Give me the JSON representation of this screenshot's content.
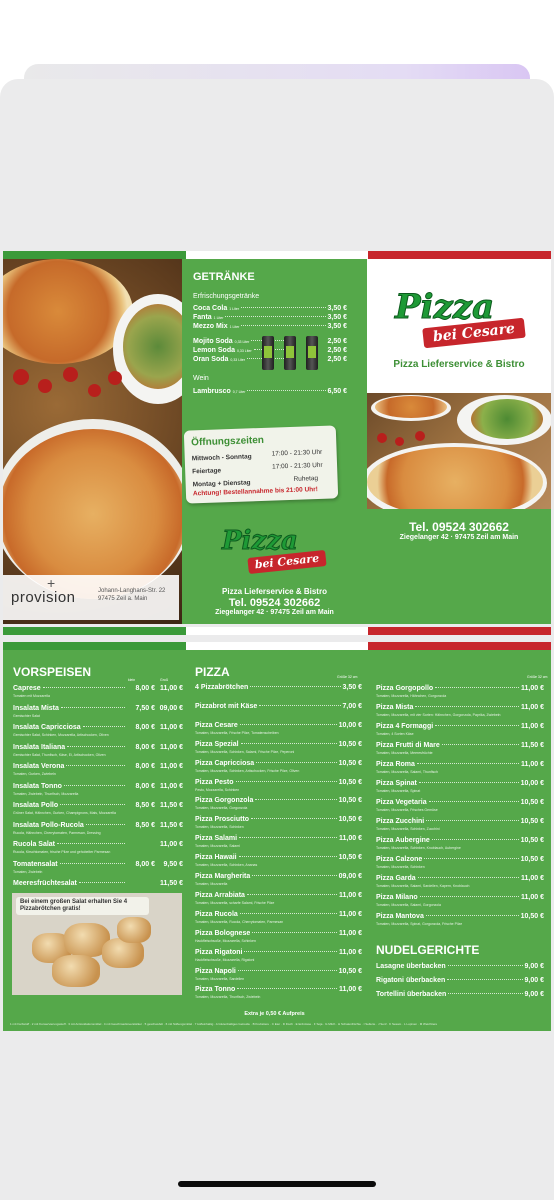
{
  "page": {
    "tops": {
      "getraenke": {
        "title": "GETRÄNKE",
        "group1": "Erfrischungsgetränke",
        "items": [
          {
            "name": "Coca Cola",
            "size": "1 Liter",
            "price": "3,50 €"
          },
          {
            "name": "Fanta",
            "size": "1 Liter",
            "price": "3,50 €"
          },
          {
            "name": "Mezzo Mix",
            "size": "1 Liter",
            "price": "3,50 €"
          },
          {
            "name": "Mojito Soda",
            "size": "0,33 Liter",
            "price": "2,50 €"
          },
          {
            "name": "Lemon Soda",
            "size": "0,33 Liter",
            "price": "2,50 €"
          },
          {
            "name": "Oran Soda",
            "size": "0,33 Liter",
            "price": "2,50 €"
          }
        ],
        "group2": "Wein",
        "wine": {
          "name": "Lambrusco",
          "size": "0,7 Liter",
          "price": "6,50 €"
        }
      },
      "oeffnung": {
        "title": "Öffnungszeiten",
        "rows": [
          {
            "day": "Mittwoch - Sonntag",
            "time": "17:00 - 21:30 Uhr"
          },
          {
            "day": "Feiertage",
            "time": "17:00 - 21:30 Uhr"
          },
          {
            "day": "Montag + Dienstag",
            "time": "Ruhetag"
          }
        ],
        "warning": "Achtung! Bestellannahme bis 21:00 Uhr!"
      },
      "center_logo": {
        "pizza": "Pizza",
        "bei": "bei Cesare"
      },
      "center_info": {
        "name": "Pizza Lieferservice & Bistro",
        "tel": "Tel. 09524  302662",
        "address": "Ziegelanger 42 · 97475 Zeil am Main"
      },
      "right_logo": {
        "pizza": "Pizza",
        "bei": "bei Cesare"
      },
      "right_info": {
        "subtitle": "Pizza Lieferservice & Bistro",
        "tel": "Tel. 09524 302662",
        "address": "Ziegelanger 42 · 97475 Zeil am Main"
      },
      "provision": {
        "brand": "provision",
        "addr1": "Johann-Langhans-Str. 22",
        "addr2": "97475 Zeil a. Main"
      }
    },
    "vorspeisen": {
      "title": "VORSPEISEN",
      "col1": "klein",
      "col2": "Groß",
      "items": [
        {
          "name": "Caprese",
          "desc": "Tomaten mit Mozzarella",
          "p1": "8,00 €",
          "p2": "11,00 €"
        },
        {
          "name": "Insalata Mista",
          "desc": "Gemischter Salat",
          "p1": "7,50 €",
          "p2": "09,00 €"
        },
        {
          "name": "Insalata Capricciosa",
          "desc": "Gemischter Salat, Schinken, Mozzarella, Artischocken, Oliven",
          "p1": "8,00 €",
          "p2": "11,00 €"
        },
        {
          "name": "Insalata Italiana",
          "desc": "Gemischter Salat, Thunfisch, Käse, Ei, Artischocken, Oliven",
          "p1": "8,00 €",
          "p2": "11,00 €"
        },
        {
          "name": "Insalata Verona",
          "desc": "Tomaten, Gurken, Zwiebeln",
          "p1": "8,00 €",
          "p2": "11,00 €"
        },
        {
          "name": "Insalata Tonno",
          "desc": "Tomaten, Zwiebeln, Thunfisch, Mozzarella",
          "p1": "8,00 €",
          "p2": "11,00 €"
        },
        {
          "name": "Insalata Pollo",
          "desc": "Grüner Salat, Hähnchen, Gurken, Champignons, Mais, Mozzarella",
          "p1": "8,50 €",
          "p2": "11,50 €"
        },
        {
          "name": "Insalata Pollo-Rucola",
          "desc": "Rucola, Hähnchen, Cherrytomaten, Parmesan, Dressing",
          "p1": "8,50 €",
          "p2": "11,50 €"
        },
        {
          "name": "Rucola Salat",
          "desc": "Rucola, Kirschtomaten, frische Pilze und gehobelter Parmesan",
          "p1": "",
          "p2": "11,00 €"
        },
        {
          "name": "Tomatensalat",
          "desc": "Tomaten, Zwiebeln",
          "p1": "8,00 €",
          "p2": "9,50 €"
        },
        {
          "name": "Meeresfrüchtesalat",
          "desc": "",
          "p1": "",
          "p2": "11,50 €"
        }
      ],
      "promo": "Bei einem großen Salat erhalten Sie 4 Pizzabrötchen gratis!"
    },
    "pizza": {
      "title": "PIZZA",
      "size": "Größe 32 cm",
      "left": [
        {
          "name": "4 Pizzabrötchen",
          "desc": "",
          "price": "3,50 €"
        },
        {
          "name": "Pizzabrot mit Käse",
          "desc": "",
          "price": "7,00 €"
        },
        {
          "name": "Pizza Cesare",
          "desc": "Tomaten, Mozzarella, Frische Pilze, Tomatenscheiben",
          "price": "10,00 €"
        },
        {
          "name": "Pizza Spezial",
          "desc": "Tomaten, Mozzarella, Schinken, Salami, Frische Pilze, Peperoni",
          "price": "10,50 €"
        },
        {
          "name": "Pizza Capricciosa",
          "desc": "Tomaten, Mozzarella, Schinken, Artischocken, Frische Pilze, Oliven",
          "price": "10,50 €"
        },
        {
          "name": "Pizza Pesto",
          "desc": "Pesto, Mozzarella, Schinken",
          "price": "10,50 €"
        },
        {
          "name": "Pizza Gorgonzola",
          "desc": "Tomaten, Mozzarella, Gorgonzola",
          "price": "10,50 €"
        },
        {
          "name": "Pizza Prosciutto",
          "desc": "Tomaten, Mozzarella, Schinken",
          "price": "10,50 €"
        },
        {
          "name": "Pizza Salami",
          "desc": "Tomaten, Mozzarella, Salami",
          "price": "11,00 €"
        },
        {
          "name": "Pizza Hawaii",
          "desc": "Tomaten, Mozzarella, Schinken, Ananas",
          "price": "10,50 €"
        },
        {
          "name": "Pizza Margherita",
          "desc": "Tomaten, Mozzarella",
          "price": "09,00 €"
        },
        {
          "name": "Pizza Arrabiata",
          "desc": "Tomaten, Mozzarella, scharfe Salami, Frische Pilze",
          "price": "11,00 €"
        },
        {
          "name": "Pizza Rucola",
          "desc": "Tomaten, Mozzarella, Rucola, Cherrytomaten, Parmesan",
          "price": "11,00 €"
        },
        {
          "name": "Pizza Bolognese",
          "desc": "Hackfleischsoße, Mozzarella, Schinken",
          "price": "11,00 €"
        },
        {
          "name": "Pizza Rigatoni",
          "desc": "Hackfleischsoße, Mozzarella, Rigatoni",
          "price": "11,00 €"
        },
        {
          "name": "Pizza Napoli",
          "desc": "Tomaten, Mozzarella, Sardellen",
          "price": "10,50 €"
        },
        {
          "name": "Pizza Tonno",
          "desc": "Tomaten, Mozzarella, Thunfisch, Zwiebeln",
          "price": "11,00 €"
        }
      ],
      "right": [
        {
          "name": "Pizza Gorgopollo",
          "desc": "Tomaten, Mozzarella, Hähnchen, Gorgonzola",
          "price": "11,00 €"
        },
        {
          "name": "Pizza Mista",
          "desc": "Tomaten, Mozzarella, mit vier Sorten: Hähnchen, Gorgonzola, Paprika, Zwiebeln",
          "price": "11,00 €"
        },
        {
          "name": "Pizza 4 Formaggi",
          "desc": "Tomaten, 4 Sorten Käse",
          "price": "11,00 €"
        },
        {
          "name": "Pizza Frutti di Mare",
          "desc": "Tomaten, Mozzarella, Meeresfrüchte",
          "price": "11,50 €"
        },
        {
          "name": "Pizza Roma",
          "desc": "Tomaten, Mozzarella, Salami, Thunfisch",
          "price": "11,00 €"
        },
        {
          "name": "Pizza Spinat",
          "desc": "Tomaten, Mozzarella, Spinat",
          "price": "10,00 €"
        },
        {
          "name": "Pizza Vegetaria",
          "desc": "Tomaten, Mozzarella, Frisches Gemüse",
          "price": "10,50 €"
        },
        {
          "name": "Pizza Zucchini",
          "desc": "Tomaten, Mozzarella, Schinken, Zucchini",
          "price": "10,50 €"
        },
        {
          "name": "Pizza Aubergine",
          "desc": "Tomaten, Mozzarella, Schinken, Knoblauch, Aubergine",
          "price": "10,50 €"
        },
        {
          "name": "Pizza Calzone",
          "desc": "Tomaten, Mozzarella, Schinken",
          "price": "10,50 €"
        },
        {
          "name": "Pizza Garda",
          "desc": "Tomaten, Mozzarella, Salami, Sardellen, Kapern, Knoblauch",
          "price": "11,00 €"
        },
        {
          "name": "Pizza Milano",
          "desc": "Tomaten, Mozzarella, Salami, Gorgonzola",
          "price": "11,00 €"
        },
        {
          "name": "Pizza Mantova",
          "desc": "Tomaten, Mozzarella, Spinat, Gorgonzola, Frische Pilze",
          "price": "10,50 €"
        }
      ],
      "extra": "Extra je 0,50 € Aufpreis"
    },
    "nudel": {
      "title": "NUDELGERICHTE",
      "items": [
        {
          "name": "Lasagne überbacken",
          "price": "9,00 €"
        },
        {
          "name": "Rigatoni überbacken",
          "price": "9,00 €"
        },
        {
          "name": "Tortellini überbacken",
          "price": "9,00 €"
        }
      ]
    },
    "legend": "1 mit Farbstoff · 2 mit Konservierungsstoff · 3 mit Antioxidationsmittel · 4 mit Geschmacksverstärker · 5 geschwefelt · 6 mit Süßungsmittel · 7 koffeinhaltig · A Glutenhaltiges Getreide · B Krebstiere · C Eier · D Fisch · E Erdnüsse · F Soja · G Milch · H Schalenfrüchte · I Sellerie · J Senf · K Sesam · L Lupinen · M Weichtiere"
  }
}
